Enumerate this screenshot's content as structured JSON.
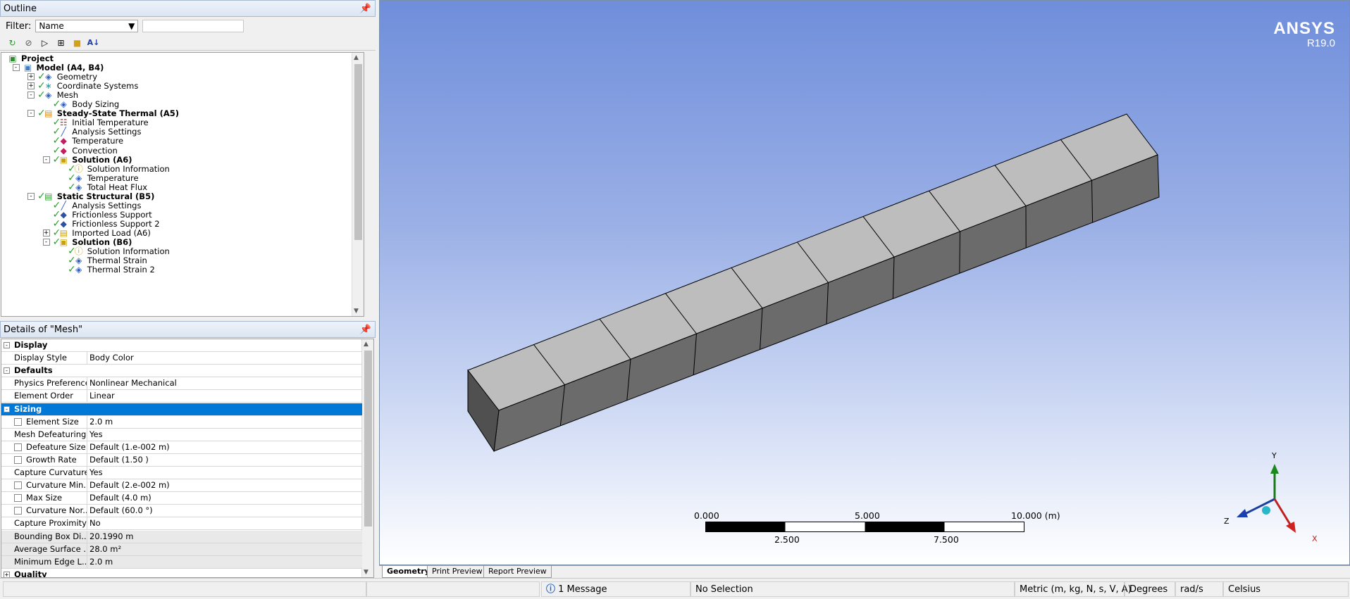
{
  "outline": {
    "title": "Outline",
    "pin": "⯐",
    "filter_label": "Filter:",
    "filter_value": "Name",
    "tree": [
      {
        "label": "Project",
        "bold": true,
        "level": 0,
        "icon": "project-icon",
        "exp": "",
        "check": false
      },
      {
        "label": "Model (A4, B4)",
        "bold": true,
        "level": 1,
        "icon": "model-icon",
        "exp": "-",
        "check": false
      },
      {
        "label": "Geometry",
        "bold": false,
        "level": 2,
        "icon": "geometry-icon",
        "exp": "+",
        "check": true
      },
      {
        "label": "Coordinate Systems",
        "bold": false,
        "level": 2,
        "icon": "coordinate-systems-icon",
        "exp": "+",
        "check": true
      },
      {
        "label": "Mesh",
        "bold": false,
        "level": 2,
        "icon": "mesh-icon",
        "exp": "-",
        "check": true
      },
      {
        "label": "Body Sizing",
        "bold": false,
        "level": 3,
        "icon": "body-sizing-icon",
        "exp": "",
        "check": true
      },
      {
        "label": "Steady-State Thermal (A5)",
        "bold": true,
        "level": 2,
        "icon": "thermal-analysis-icon",
        "exp": "-",
        "check": true
      },
      {
        "label": "Initial Temperature",
        "bold": false,
        "level": 3,
        "icon": "initial-temperature-icon",
        "exp": "",
        "check": true
      },
      {
        "label": "Analysis Settings",
        "bold": false,
        "level": 3,
        "icon": "analysis-settings-icon",
        "exp": "",
        "check": true
      },
      {
        "label": "Temperature",
        "bold": false,
        "level": 3,
        "icon": "temperature-load-icon",
        "exp": "",
        "check": true
      },
      {
        "label": "Convection",
        "bold": false,
        "level": 3,
        "icon": "convection-icon",
        "exp": "",
        "check": true
      },
      {
        "label": "Solution (A6)",
        "bold": true,
        "level": 3,
        "icon": "solution-icon",
        "exp": "-",
        "check": true
      },
      {
        "label": "Solution Information",
        "bold": false,
        "level": 4,
        "icon": "solution-information-icon",
        "exp": "",
        "check": true
      },
      {
        "label": "Temperature",
        "bold": false,
        "level": 4,
        "icon": "result-icon",
        "exp": "",
        "check": true
      },
      {
        "label": "Total Heat Flux",
        "bold": false,
        "level": 4,
        "icon": "result-icon",
        "exp": "",
        "check": true
      },
      {
        "label": "Static Structural (B5)",
        "bold": true,
        "level": 2,
        "icon": "structural-analysis-icon",
        "exp": "-",
        "check": true
      },
      {
        "label": "Analysis Settings",
        "bold": false,
        "level": 3,
        "icon": "analysis-settings-icon",
        "exp": "",
        "check": true
      },
      {
        "label": "Frictionless Support",
        "bold": false,
        "level": 3,
        "icon": "support-icon",
        "exp": "",
        "check": true
      },
      {
        "label": "Frictionless Support 2",
        "bold": false,
        "level": 3,
        "icon": "support-icon",
        "exp": "",
        "check": true
      },
      {
        "label": "Imported Load (A6)",
        "bold": false,
        "level": 3,
        "icon": "imported-load-icon",
        "exp": "+",
        "check": true
      },
      {
        "label": "Solution (B6)",
        "bold": true,
        "level": 3,
        "icon": "solution-icon",
        "exp": "-",
        "check": true
      },
      {
        "label": "Solution Information",
        "bold": false,
        "level": 4,
        "icon": "solution-information-icon",
        "exp": "",
        "check": true
      },
      {
        "label": "Thermal Strain",
        "bold": false,
        "level": 4,
        "icon": "result-icon",
        "exp": "",
        "check": true
      },
      {
        "label": "Thermal Strain 2",
        "bold": false,
        "level": 4,
        "icon": "result-icon",
        "exp": "",
        "check": true
      }
    ]
  },
  "details": {
    "title": "Details of \"Mesh\"",
    "rows": [
      {
        "type": "group",
        "name": "Display"
      },
      {
        "type": "row",
        "name": "Display Style",
        "value": "Body Color"
      },
      {
        "type": "group",
        "name": "Defaults"
      },
      {
        "type": "row",
        "name": "Physics Preference",
        "value": "Nonlinear Mechanical"
      },
      {
        "type": "row",
        "name": "Element Order",
        "value": "Linear"
      },
      {
        "type": "group",
        "name": "Sizing",
        "selected": true
      },
      {
        "type": "row",
        "name": "Element Size",
        "value": "2.0 m",
        "checkbox": true
      },
      {
        "type": "row",
        "name": "Mesh Defeaturing",
        "value": "Yes"
      },
      {
        "type": "row",
        "name": "Defeature Size",
        "value": "Default (1.e-002 m)",
        "checkbox": true
      },
      {
        "type": "row",
        "name": "Growth Rate",
        "value": "Default (1.50 )",
        "checkbox": true
      },
      {
        "type": "row",
        "name": "Capture Curvature",
        "value": "Yes"
      },
      {
        "type": "row",
        "name": "Curvature Min...",
        "value": "Default (2.e-002 m)",
        "checkbox": true
      },
      {
        "type": "row",
        "name": "Max Size",
        "value": "Default (4.0 m)",
        "checkbox": true
      },
      {
        "type": "row",
        "name": "Curvature Nor...",
        "value": "Default (60.0 °)",
        "checkbox": true
      },
      {
        "type": "row",
        "name": "Capture Proximity",
        "value": "No"
      },
      {
        "type": "row",
        "name": "Bounding Box Di...",
        "value": "20.1990 m",
        "gray": true
      },
      {
        "type": "row",
        "name": "Average Surface ...",
        "value": "28.0 m²",
        "gray": true
      },
      {
        "type": "row",
        "name": "Minimum Edge L...",
        "value": "2.0 m",
        "gray": true
      },
      {
        "type": "group",
        "name": "Quality",
        "collapsed": true
      }
    ]
  },
  "viewport": {
    "brand": "ANSYS",
    "version": "R19.0",
    "scale_top": [
      "0.000",
      "5.000",
      "10.000 (m)"
    ],
    "scale_bottom": [
      "2.500",
      "7.500"
    ],
    "axes": {
      "x": "X",
      "y": "Y",
      "z": "Z"
    },
    "tabs": [
      "Geometry",
      "Print Preview",
      "Report Preview"
    ],
    "active_tab": 0,
    "block_segments": 10,
    "colors": {
      "top_face": "#bdbdbd",
      "side_face": "#6b6b6b",
      "end_face": "#505050",
      "edge": "#000000"
    }
  },
  "status": {
    "messages": "1 Message",
    "selection": "No Selection",
    "units": "Metric (m, kg, N, s, V, A)",
    "angle": "Degrees",
    "rate": "rad/s",
    "temp": "Celsius"
  }
}
